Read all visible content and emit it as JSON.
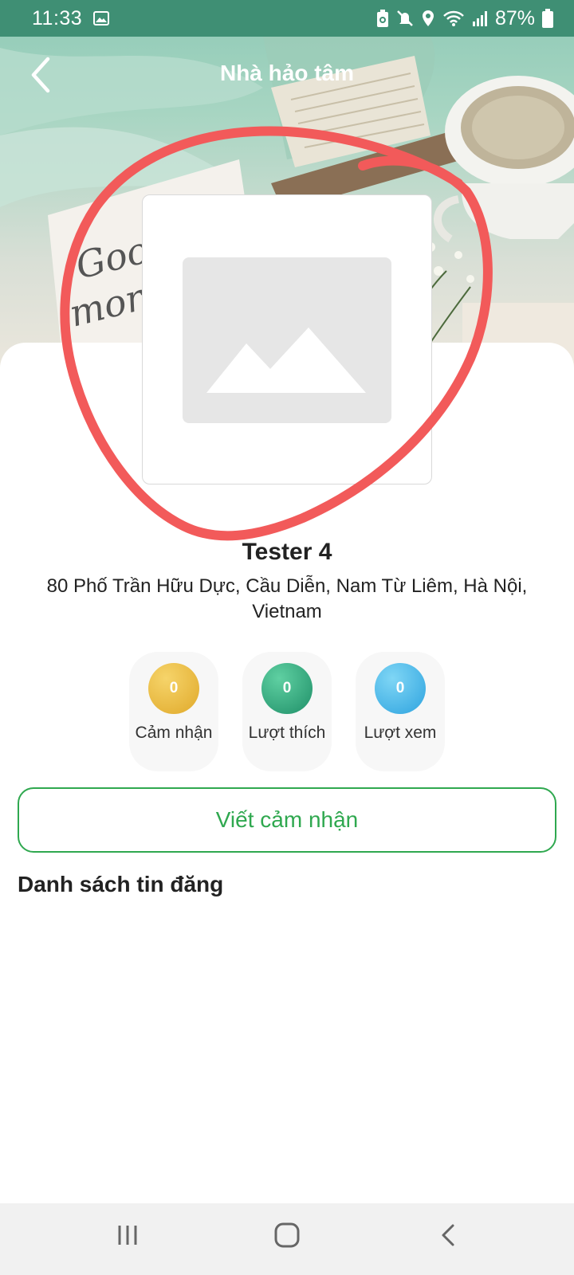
{
  "status_bar": {
    "time": "11:33",
    "battery": "87%",
    "icons": [
      "image-icon",
      "battery-saver-icon",
      "mute-icon",
      "location-icon",
      "wifi-icon",
      "signal-icon",
      "battery-icon"
    ]
  },
  "header": {
    "title": "Nhà hảo tâm",
    "back_icon": "chevron-left-icon"
  },
  "profile": {
    "avatar_icon": "image-placeholder-icon",
    "name": "Tester 4",
    "address": "80 Phố Trần Hữu Dực, Cầu Diễn, Nam Từ Liêm, Hà Nội, Vietnam"
  },
  "stats": [
    {
      "value": "0",
      "label": "Cảm nhận",
      "color": "#e9b93a"
    },
    {
      "value": "0",
      "label": "Lượt thích",
      "color": "#2ea57a"
    },
    {
      "value": "0",
      "label": "Lượt xem",
      "color": "#3cb4e6"
    }
  ],
  "actions": {
    "write_review": "Viết cảm nhận"
  },
  "posts_section": {
    "title": "Danh sách tin đăng"
  },
  "nav_bar": {
    "icons": [
      "recent-apps-icon",
      "home-icon",
      "back-icon"
    ]
  },
  "colors": {
    "accent_green": "#2fa84f",
    "status_bar": "#3f8f74",
    "annotation_red": "#f25a5a"
  }
}
